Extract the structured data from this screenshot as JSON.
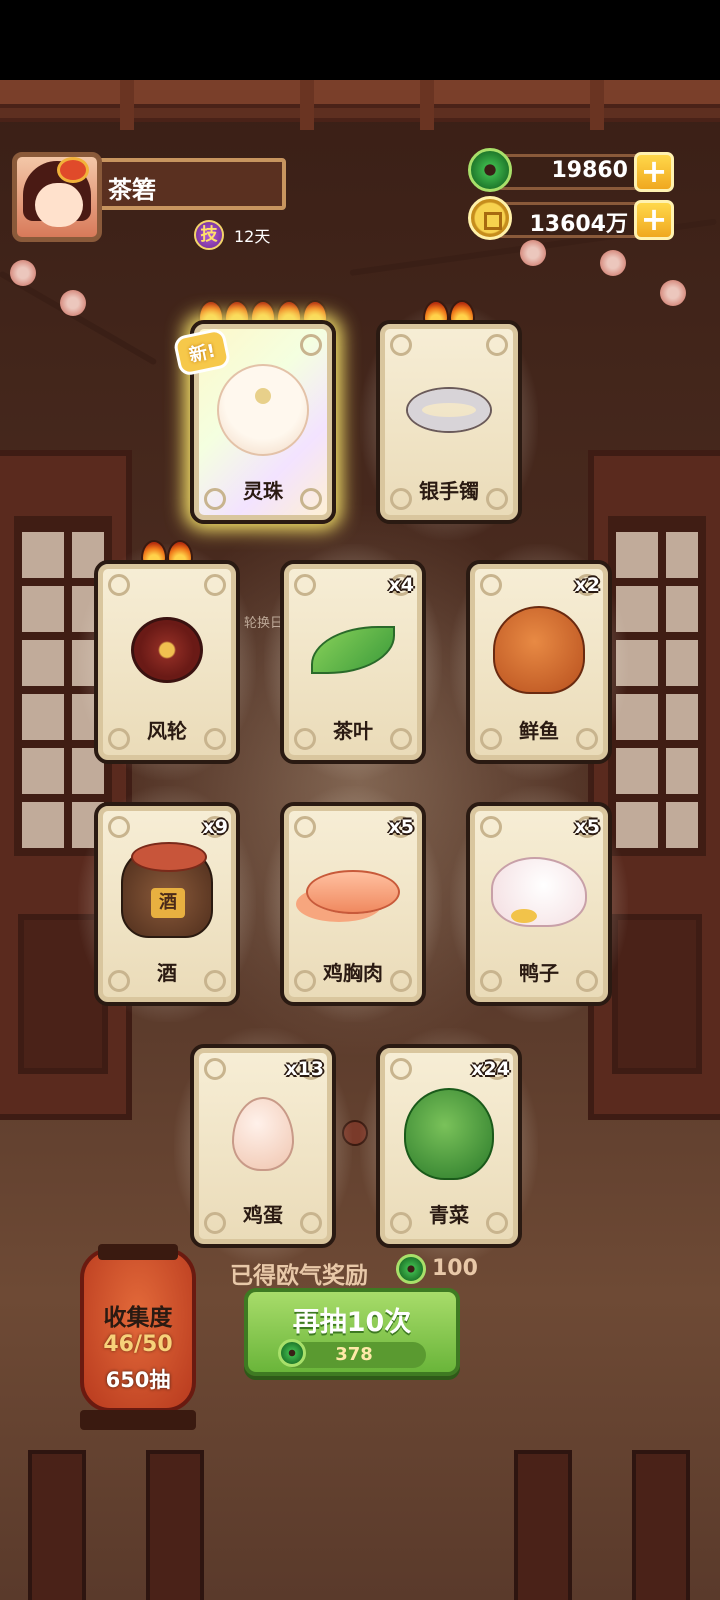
{
  "player": {
    "name": "茶箬",
    "skill_badge": "技",
    "skill_days": "12天"
  },
  "currencies": [
    {
      "icon": "jade-icon",
      "value": "19860"
    },
    {
      "icon": "coin-icon",
      "value": "13604万"
    }
  ],
  "calendar_label": "轮换日历",
  "cards": [
    {
      "label": "灵珠",
      "count": "",
      "flames": 5,
      "is_new": true,
      "new_label": "新!",
      "icon": "spirit-pearl-icon"
    },
    {
      "label": "银手镯",
      "count": "",
      "flames": 2,
      "is_new": false,
      "icon": "silver-bracelet-icon"
    },
    {
      "label": "风轮",
      "count": "",
      "flames": 2,
      "is_new": false,
      "icon": "wind-wheel-icon"
    },
    {
      "label": "茶叶",
      "count": "x4",
      "flames": 0,
      "is_new": false,
      "icon": "tea-leaf-icon"
    },
    {
      "label": "鲜鱼",
      "count": "x2",
      "flames": 0,
      "is_new": false,
      "icon": "fish-icon"
    },
    {
      "label": "酒",
      "count": "x9",
      "flames": 0,
      "is_new": false,
      "icon": "wine-jar-icon",
      "jar_text": "酒"
    },
    {
      "label": "鸡胸肉",
      "count": "x5",
      "flames": 0,
      "is_new": false,
      "icon": "chicken-breast-icon"
    },
    {
      "label": "鸭子",
      "count": "x5",
      "flames": 0,
      "is_new": false,
      "icon": "duck-icon"
    },
    {
      "label": "鸡蛋",
      "count": "x13",
      "flames": 0,
      "is_new": false,
      "icon": "egg-icon"
    },
    {
      "label": "青菜",
      "count": "x24",
      "flames": 0,
      "is_new": false,
      "icon": "greens-icon"
    }
  ],
  "reward": {
    "text": "已得欧气奖励",
    "value": "100"
  },
  "draw_button": {
    "label": "再抽10次",
    "cost": "378"
  },
  "collection": {
    "title": "收集度",
    "progress": "46/50",
    "draws": "650抽"
  }
}
